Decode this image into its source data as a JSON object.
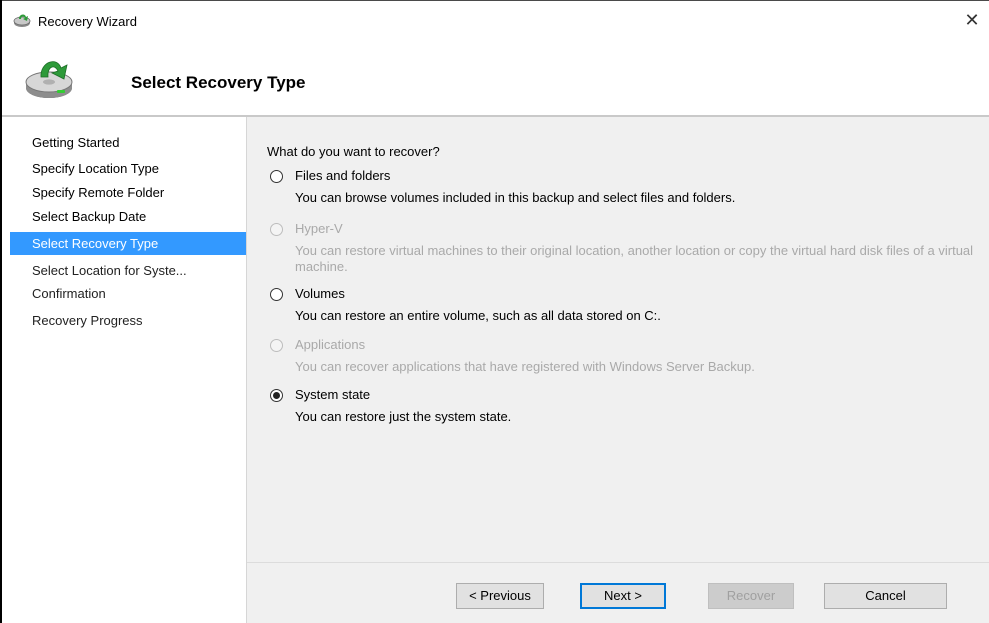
{
  "window": {
    "title": "Recovery Wizard",
    "close_label": "✕"
  },
  "header": {
    "title": "Select Recovery Type"
  },
  "nav": {
    "items": [
      {
        "label": "Getting Started"
      },
      {
        "label": "Specify Location Type"
      },
      {
        "label": "Specify Remote Folder"
      },
      {
        "label": "Select Backup Date"
      },
      {
        "label": "Select Recovery Type"
      },
      {
        "label": "Select Location for Syste..."
      },
      {
        "label": "Confirmation"
      },
      {
        "label": "Recovery Progress"
      }
    ],
    "selected": "Select Recovery Type"
  },
  "content": {
    "question": "What do you want to recover?",
    "options": [
      {
        "label": "Files and folders",
        "description": "You can browse volumes included in this backup and select files and folders.",
        "enabled": true,
        "checked": false
      },
      {
        "label": "Hyper-V",
        "description": "You can restore virtual machines to their original location, another location or copy the virtual hard disk files of a virtual machine.",
        "enabled": false,
        "checked": false
      },
      {
        "label": "Volumes",
        "description": "You can restore an entire volume, such as all data stored on C:.",
        "enabled": true,
        "checked": false
      },
      {
        "label": "Applications",
        "description": "You can recover applications that have registered with Windows Server Backup.",
        "enabled": false,
        "checked": false
      },
      {
        "label": "System state",
        "description": "You can restore just the system state.",
        "enabled": true,
        "checked": true
      }
    ]
  },
  "footer": {
    "previous_label": "< Previous",
    "next_label": "Next >",
    "recover_label": "Recover",
    "cancel_label": "Cancel"
  },
  "colors": {
    "selection": "#3399ff",
    "content_bg": "#f0f0f0",
    "disabled_text": "#a9a9a9",
    "default_button_border": "#0078d7"
  },
  "icons": {
    "app": "recovery-wizard-icon",
    "header": "disk-recovery-icon",
    "close": "close-icon"
  }
}
